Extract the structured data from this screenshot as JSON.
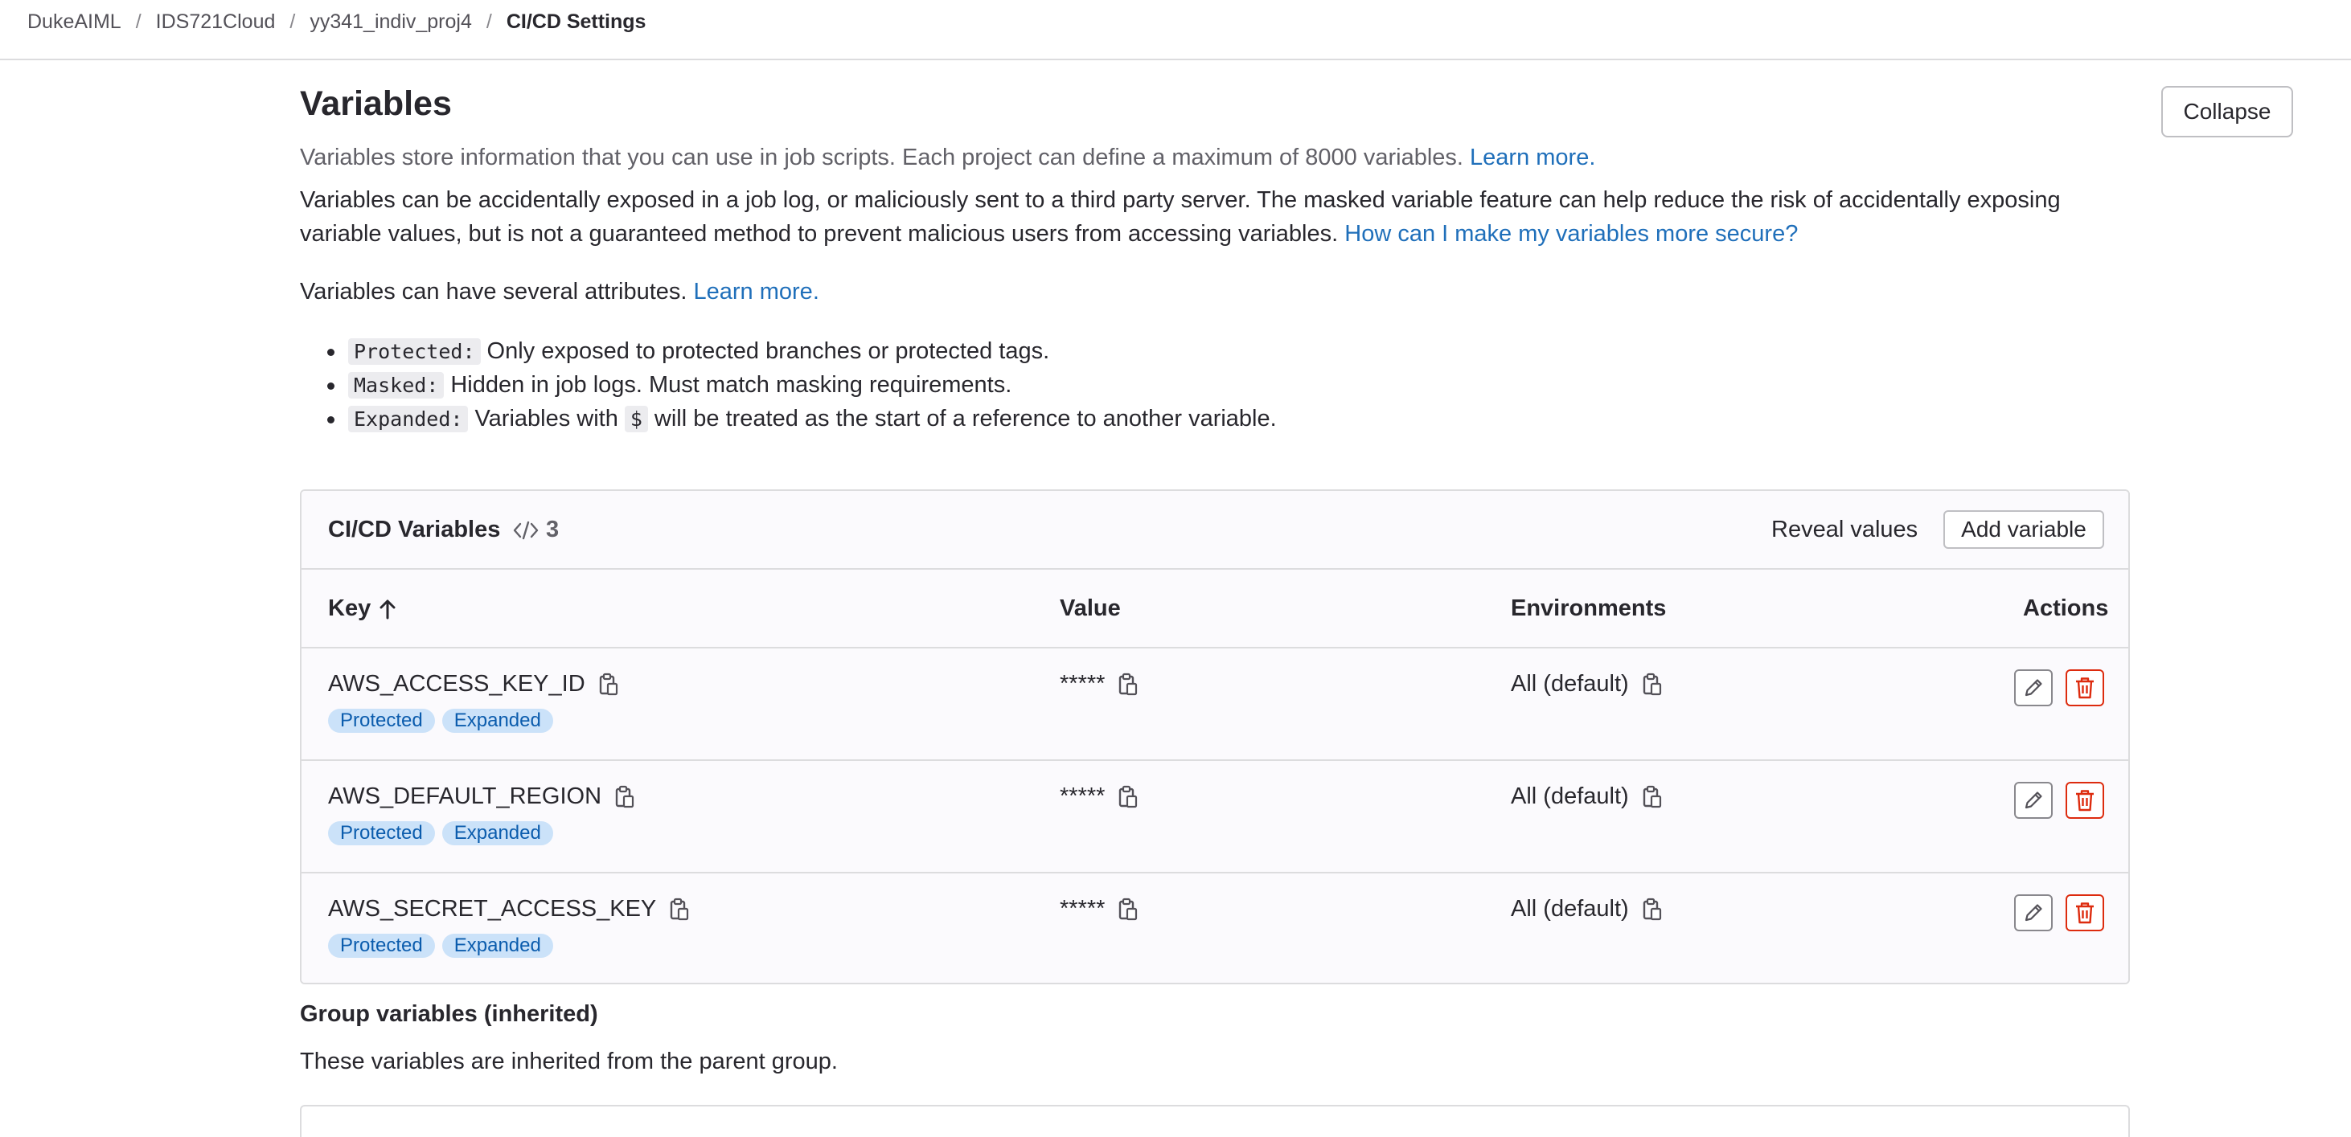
{
  "breadcrumb": {
    "items": [
      "DukeAIML",
      "IDS721Cloud",
      "yy341_indiv_proj4",
      "CI/CD Settings"
    ],
    "separator": "/"
  },
  "section": {
    "title": "Variables",
    "collapse_label": "Collapse",
    "description": "Variables store information that you can use in job scripts. Each project can define a maximum of 8000 variables.",
    "learn_more": "Learn more.",
    "warning_text": "Variables can be accidentally exposed in a job log, or maliciously sent to a third party server. The masked variable feature can help reduce the risk of accidentally exposing variable values, but is not a guaranteed method to prevent malicious users from accessing variables.",
    "warning_link": "How can I make my variables more secure?",
    "attributes_text": "Variables can have several attributes.",
    "attributes_link": "Learn more.",
    "attributes": [
      {
        "code": "Protected:",
        "text": "Only exposed to protected branches or protected tags."
      },
      {
        "code": "Masked:",
        "text": "Hidden in job logs. Must match masking requirements."
      },
      {
        "code": "Expanded:",
        "text_before": "Variables with",
        "inline_code": "$",
        "text_after": "will be treated as the start of a reference to another variable."
      }
    ]
  },
  "variables_card": {
    "title": "CI/CD Variables",
    "count": "3",
    "reveal_label": "Reveal values",
    "add_label": "Add variable",
    "columns": {
      "key": "Key",
      "value": "Value",
      "environments": "Environments",
      "actions": "Actions"
    },
    "rows": [
      {
        "key": "AWS_ACCESS_KEY_ID",
        "value": "*****",
        "environment": "All (default)",
        "badges": [
          "Protected",
          "Expanded"
        ]
      },
      {
        "key": "AWS_DEFAULT_REGION",
        "value": "*****",
        "environment": "All (default)",
        "badges": [
          "Protected",
          "Expanded"
        ]
      },
      {
        "key": "AWS_SECRET_ACCESS_KEY",
        "value": "*****",
        "environment": "All (default)",
        "badges": [
          "Protected",
          "Expanded"
        ]
      }
    ]
  },
  "group": {
    "title": "Group variables (inherited)",
    "description": "These variables are inherited from the parent group."
  },
  "icons": {
    "copy": "copy-to-clipboard-icon",
    "edit": "pencil-icon",
    "delete": "trash-icon",
    "sort": "arrow-up-icon",
    "code": "code-icon"
  },
  "colors": {
    "link": "#1f6fba",
    "badge_bg": "#cbe2f9",
    "badge_text": "#0b5cad",
    "danger": "#dd2b0e"
  }
}
